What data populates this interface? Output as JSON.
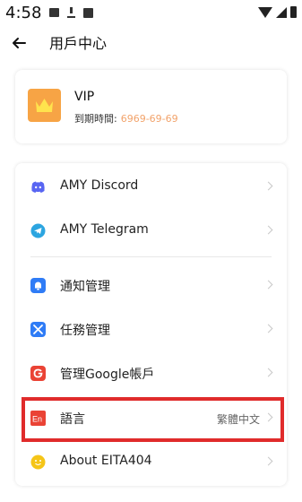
{
  "status_bar": {
    "time": "4:58",
    "left_icons": [
      "image-icon",
      "download-icon",
      "app-icon"
    ],
    "right_icons": [
      "wifi-icon",
      "signal-icon",
      "battery-icon"
    ]
  },
  "header": {
    "title": "用戶中心",
    "back_icon": "arrow-left-icon"
  },
  "vip": {
    "title": "VIP",
    "expire_label": "到期時間:",
    "expire_date": "6969-69-69",
    "icon": "crown-icon",
    "accent_color": "#f7a445"
  },
  "menu": {
    "items": [
      {
        "label": "AMY Discord",
        "icon": "discord-icon",
        "color": "#5865f2"
      },
      {
        "label": "AMY Telegram",
        "icon": "telegram-icon",
        "color": "#2ca5e0"
      },
      {
        "label": "通知管理",
        "icon": "bell-icon",
        "color": "#2f7cf6"
      },
      {
        "label": "任務管理",
        "icon": "tools-icon",
        "color": "#2f7cf6"
      },
      {
        "label": "管理Google帳戶",
        "icon": "google-icon",
        "color": "#ea4335"
      },
      {
        "label": "語言",
        "value": "繁體中文",
        "icon": "language-icon",
        "color": "#ea4335"
      },
      {
        "label": "About EITA404",
        "icon": "smile-icon",
        "color": "#f5c518"
      }
    ]
  },
  "highlight_color": "#e02b2b"
}
